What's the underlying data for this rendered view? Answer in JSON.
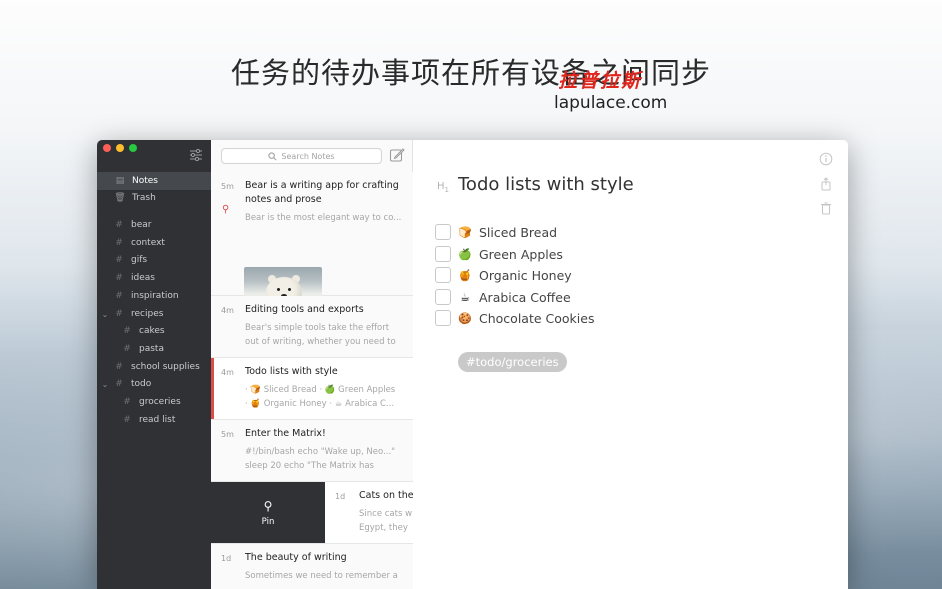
{
  "banner": {
    "headline": "任务的待办事项在所有设备之间同步",
    "watermark_cn": "拉普拉斯",
    "watermark_en": "lapulace.com"
  },
  "sidebar": {
    "primary": [
      {
        "label": "Notes",
        "icon": "notes-icon",
        "selected": true
      },
      {
        "label": "Trash",
        "icon": "trash-icon",
        "selected": false
      }
    ],
    "tags": [
      {
        "label": "bear"
      },
      {
        "label": "context"
      },
      {
        "label": "gifs"
      },
      {
        "label": "ideas"
      },
      {
        "label": "inspiration"
      },
      {
        "label": "recipes",
        "expanded": true
      },
      {
        "label": "cakes",
        "child": true
      },
      {
        "label": "pasta",
        "child": true
      },
      {
        "label": "school supplies"
      },
      {
        "label": "todo",
        "expanded": true
      },
      {
        "label": "groceries",
        "child": true
      },
      {
        "label": "read list",
        "child": true
      }
    ]
  },
  "search": {
    "placeholder": "Search Notes"
  },
  "notes": [
    {
      "time": "5m",
      "title": "Bear is a writing app for crafting notes and prose",
      "preview": "Bear is the most elegant way to co..."
    },
    {
      "time": "4m",
      "title": "Editing tools and exports",
      "preview": "Bear's simple tools take the effort out of writing, whether you need to hit..."
    },
    {
      "time": "4m",
      "title": "Todo lists with style",
      "preview_line1": "· 🍞 Sliced Bread · 🍏 Green Apples",
      "preview_line2": "· 🍯 Organic Honey · ☕ Arabica C..."
    },
    {
      "time": "5m",
      "title": "Enter the Matrix!",
      "preview": "#!/bin/bash echo \"Wake up, Neo...\" sleep 20 echo \"The Matrix has you....\""
    },
    {
      "time": "1d",
      "title": "Cats on the",
      "preview": "Since cats w Egypt, they w"
    },
    {
      "time": "1d",
      "title": "The beauty of writing",
      "preview": "Sometimes we need to remember a"
    }
  ],
  "pin_action": {
    "label": "Pin"
  },
  "editor": {
    "heading_marker": "H",
    "heading_level": "1",
    "title": "Todo lists with style",
    "todos": [
      {
        "emoji": "🍞",
        "text": "Sliced Bread",
        "checked": false
      },
      {
        "emoji": "🍏",
        "text": "Green Apples",
        "checked": false
      },
      {
        "emoji": "🍯",
        "text": "Organic Honey",
        "checked": false
      },
      {
        "emoji": "☕",
        "text": "Arabica Coffee",
        "checked": false
      },
      {
        "emoji": "🍪",
        "text": "Chocolate Cookies",
        "checked": false
      }
    ],
    "tag": "#todo/groceries"
  },
  "colors": {
    "accent": "#dc4c4c",
    "sidebar_bg": "#2f3134"
  }
}
